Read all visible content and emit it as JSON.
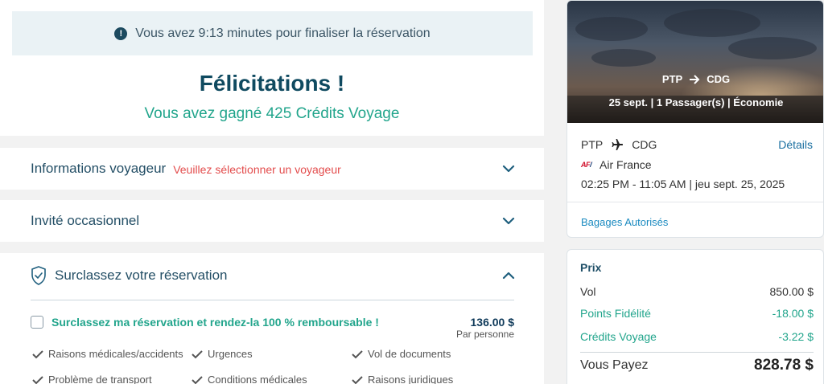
{
  "banner": {
    "timer_text": "Vous avez 9:13 minutes pour finaliser la réservation"
  },
  "congrats": {
    "title": "Félicitations !",
    "subtitle": "Vous avez gagné 425 Crédits Voyage"
  },
  "sections": {
    "traveler_info": {
      "title": "Informations voyageur",
      "warning": "Veuillez sélectionner un voyageur"
    },
    "guest": {
      "title": "Invité occasionnel"
    },
    "upgrade": {
      "title": "Surclassez votre réservation",
      "option_label": "Surclassez ma réservation et rendez-la 100 % remboursable !",
      "price": "136.00 $",
      "per_person": "Par personne",
      "reasons": [
        "Raisons médicales/accidents",
        "Urgences",
        "Vol de documents",
        "Problème de transport",
        "Conditions médicales",
        "Raisons juridiques"
      ]
    }
  },
  "flight": {
    "hero_origin": "PTP",
    "hero_destination": "CDG",
    "hero_meta": "25 sept. | 1 Passager(s) | Économie",
    "origin": "PTP",
    "destination": "CDG",
    "details_link": "Détails",
    "airline_logo": "AF",
    "airline": "Air France",
    "time": "02:25 PM - 11:05 AM | jeu sept. 25, 2025",
    "baggage_link": "Bagages Autorisés"
  },
  "price": {
    "title": "Prix",
    "rows": [
      {
        "label": "Vol",
        "value": "850.00 $"
      },
      {
        "label": "Points Fidélité",
        "value": "-18.00 $"
      },
      {
        "label": "Crédits Voyage",
        "value": "-3.22 $"
      }
    ],
    "total_label": "Vous Payez",
    "total_value": "828.78 $"
  },
  "colors": {
    "primary": "#0f4a60",
    "accent_green": "#22a58c",
    "warning_red": "#e34c4c",
    "link_blue": "#1a6fa0"
  }
}
